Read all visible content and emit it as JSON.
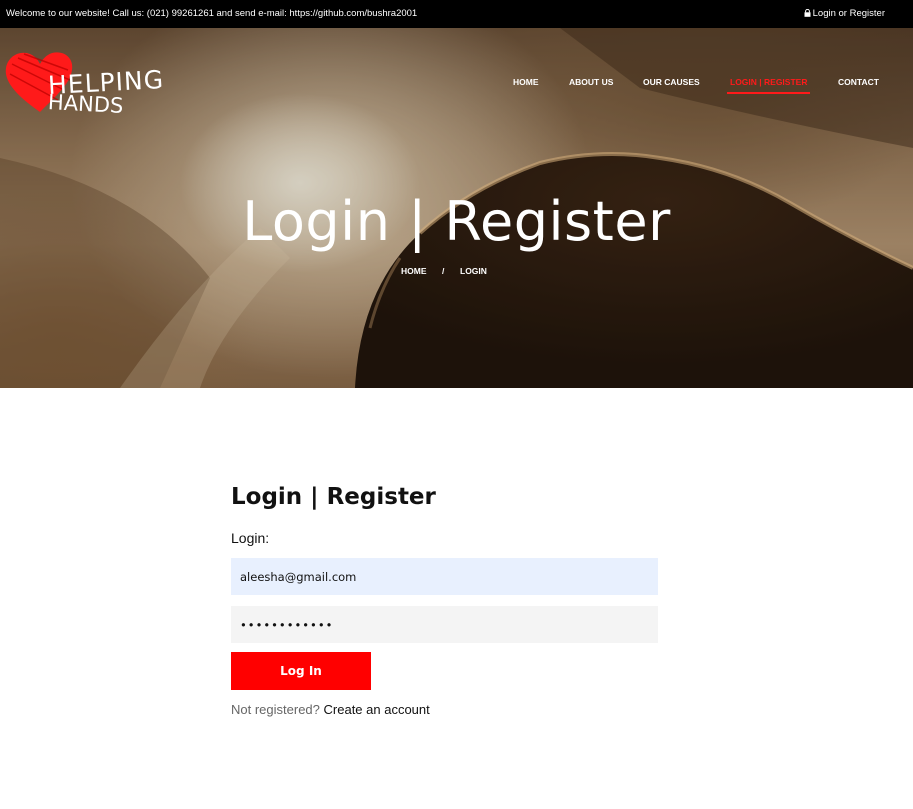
{
  "topbar": {
    "welcome": "Welcome to our website! Call us: (021) 99261261 and send e-mail: https://github.com/bushra2001",
    "account_link": "Login or Register",
    "account_icon": "lock-icon"
  },
  "logo": {
    "line1": "HELPING",
    "line2": "HANDS",
    "heart_color": "#ff1a1a"
  },
  "nav": {
    "items": [
      {
        "label": "HOME"
      },
      {
        "label": "ABOUT US"
      },
      {
        "label": "OUR CAUSES"
      },
      {
        "label": "LOGIN | REGISTER",
        "active": true
      },
      {
        "label": "CONTACT"
      }
    ],
    "active_color": "#ff1a1a"
  },
  "hero": {
    "title": "Login | Register",
    "breadcrumb": {
      "home": "HOME",
      "separator": "/",
      "current": "LOGIN"
    }
  },
  "form": {
    "heading": "Login | Register",
    "label": "Login:",
    "email_value": "aleesha@gmail.com",
    "password_value": "••••••••••••",
    "submit_label": "Log In",
    "register_prompt": "Not registered?",
    "register_link": "Create an account",
    "button_color": "#ff0000",
    "autofill_color": "#e8f0fe"
  }
}
